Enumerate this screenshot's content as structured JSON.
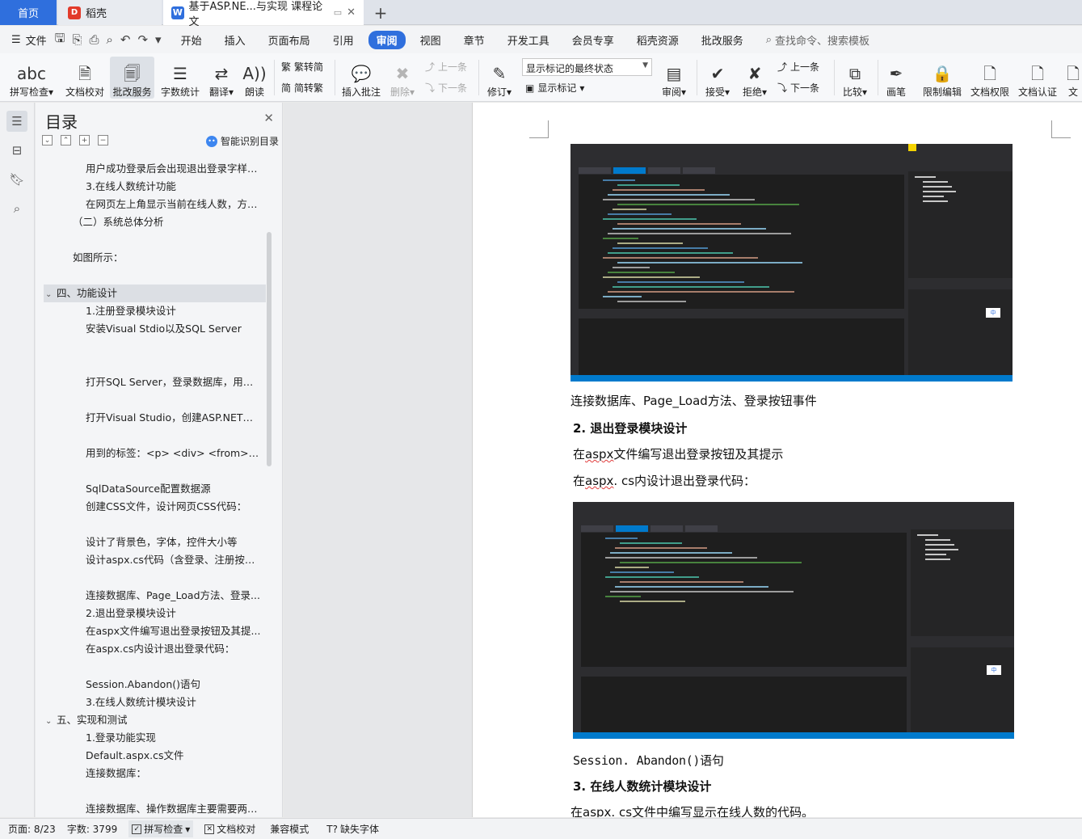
{
  "tabs": {
    "home": "首页",
    "docer": "稻壳",
    "doc": "基于ASP.NE...与实现 课程论文",
    "add": "+"
  },
  "menubar": {
    "file": "文件",
    "items": [
      "开始",
      "插入",
      "页面布局",
      "引用",
      "审阅",
      "视图",
      "章节",
      "开发工具",
      "会员专享",
      "稻壳资源",
      "批改服务"
    ],
    "active": "审阅",
    "search_placeholder": "查找命令、搜索模板"
  },
  "ribbon": {
    "spell_check": "拼写检查",
    "doc_proof": "文档校对",
    "correction_service": "批改服务",
    "word_count": "字数统计",
    "translate": "翻译",
    "read_aloud": "朗读",
    "trad_to_simp": "繁转简",
    "simp_to_trad": "简转繁",
    "insert_comment": "插入批注",
    "delete": "删除",
    "prev": "上一条",
    "next": "下一条",
    "revise": "修订",
    "markup_state": "显示标记的最终状态",
    "show_markup": "显示标记",
    "review": "审阅",
    "accept": "接受",
    "reject": "拒绝",
    "prev2": "上一条",
    "next2": "下一条",
    "compare": "比较",
    "pen": "画笔",
    "restrict_edit": "限制编辑",
    "doc_permission": "文档权限",
    "doc_auth": "文档认证",
    "doc_cut": "文"
  },
  "toc": {
    "title": "目录",
    "smart": "智能识别目录",
    "items": [
      {
        "text": "用户成功登录后会出现退出登录字样，...",
        "indent": 2
      },
      {
        "text": "3.在线人数统计功能",
        "indent": 2
      },
      {
        "text": "在网页左上角显示当前在线人数，方便...",
        "indent": 2
      },
      {
        "text": "（二）系统总体分析",
        "indent": 1
      },
      {
        "text": "",
        "indent": 2
      },
      {
        "text": "如图所示：",
        "indent": 1
      },
      {
        "text": "",
        "indent": 2
      },
      {
        "text": "四、功能设计",
        "indent": 0,
        "toggle": "⌄",
        "selected": true
      },
      {
        "text": "1.注册登录模块设计",
        "indent": 2
      },
      {
        "text": "安装Visual Stdio以及SQL Server",
        "indent": 2
      },
      {
        "text": "",
        "indent": 2
      },
      {
        "text": "",
        "indent": 2
      },
      {
        "text": "打开SQL Server，登录数据库，用户...",
        "indent": 2
      },
      {
        "text": "",
        "indent": 2
      },
      {
        "text": "打开Visual Studio，创建ASP.NET空...",
        "indent": 2
      },
      {
        "text": "",
        "indent": 2
      },
      {
        "text": "用到的标签：<p> <div> <from> <a...",
        "indent": 2
      },
      {
        "text": "",
        "indent": 2
      },
      {
        "text": "SqlDataSource配置数据源",
        "indent": 2
      },
      {
        "text": "创建CSS文件，设计网页CSS代码：",
        "indent": 2
      },
      {
        "text": "",
        "indent": 2
      },
      {
        "text": "设计了背景色，字体，控件大小等",
        "indent": 2
      },
      {
        "text": " 设计aspx.cs代码（含登录、注册按钮...",
        "indent": 2
      },
      {
        "text": "",
        "indent": 2
      },
      {
        "text": " 连接数据库、Page_Load方法、登录...",
        "indent": 2
      },
      {
        "text": "2.退出登录模块设计",
        "indent": 2
      },
      {
        "text": "在aspx文件编写退出登录按钮及其提...",
        "indent": 2
      },
      {
        "text": "在aspx.cs内设计退出登录代码：",
        "indent": 2
      },
      {
        "text": "",
        "indent": 2
      },
      {
        "text": "Session.Abandon()语句",
        "indent": 2
      },
      {
        "text": "3.在线人数统计模块设计",
        "indent": 2
      },
      {
        "text": "五、实现和测试",
        "indent": 0,
        "toggle": "⌄"
      },
      {
        "text": "1.登录功能实现",
        "indent": 2
      },
      {
        "text": "Default.aspx.cs文件",
        "indent": 2
      },
      {
        "text": "连接数据库：",
        "indent": 2
      },
      {
        "text": "",
        "indent": 2
      },
      {
        "text": "连接数据库、操作数据库主要需要两个...",
        "indent": 2
      }
    ]
  },
  "page": {
    "line1": "连接数据库、Page_Load方法、登录按钮事件",
    "h2": "2. 退出登录模块设计",
    "line2_pre": "在",
    "line2_sq": "aspx",
    "line2_post": "文件编写退出登录按钮及其提示",
    "line3_pre": "在",
    "line3_sq": "aspx",
    "line3_post": ". cs内设计退出登录代码：",
    "line4": "Session. Abandon()语句",
    "h3": "3. 在线人数统计模块设计",
    "line5_pre": "在",
    "line5_sq": "aspx",
    "line5_post": ". cs文件中编写显示在线人数的代码。"
  },
  "vs_ime": "中",
  "status": {
    "page": "页面: 8/23",
    "words": "字数: 3799",
    "spell": "拼写检查",
    "proof": "文档校对",
    "compat": "兼容模式",
    "missing_font": "缺失字体"
  },
  "colors": {
    "accent": "#2f6fdd",
    "vs_bg": "#1e1e1e",
    "vs_status": "#007acc"
  }
}
